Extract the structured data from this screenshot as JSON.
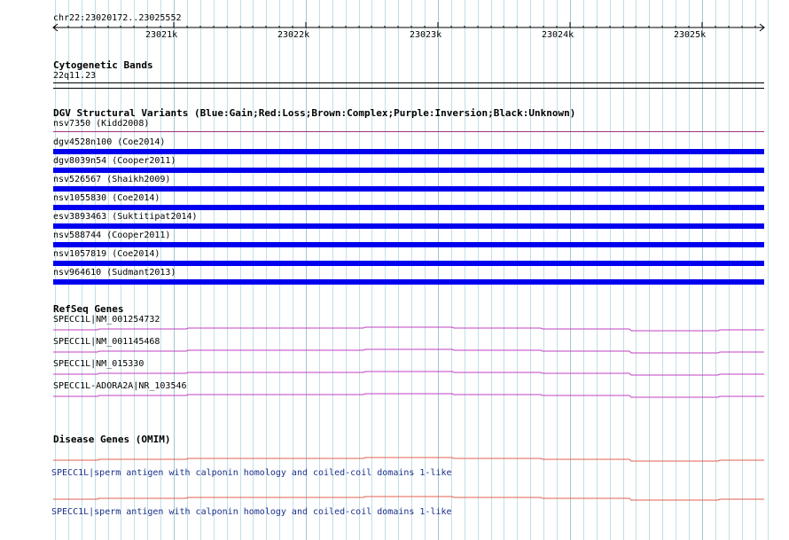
{
  "ruler": {
    "region_label": "chr22:23020172..23025552",
    "tick_labels": [
      "23021k",
      "23022k",
      "23023k",
      "23024k",
      "23025k"
    ]
  },
  "cytoband": {
    "title": "Cytogenetic Bands",
    "band": "22q11.23"
  },
  "dgv": {
    "title": "DGV Structural Variants (Blue:Gain;Red:Loss;Brown:Complex;Purple:Inversion;Black:Unknown)",
    "variants": [
      {
        "label": "nsv7350 (Kidd2008)",
        "color": "#a03080",
        "style": "thin"
      },
      {
        "label": "dgv4528n100 (Coe2014)",
        "color": "#0000ee",
        "style": "bar"
      },
      {
        "label": "dgv8039n54 (Cooper2011)",
        "color": "#0000ee",
        "style": "bar"
      },
      {
        "label": "nsv526567 (Shaikh2009)",
        "color": "#0000ee",
        "style": "bar"
      },
      {
        "label": "nsv1055830 (Coe2014)",
        "color": "#0000ee",
        "style": "bar"
      },
      {
        "label": "esv3893463 (Suktitipat2014)",
        "color": "#0000ee",
        "style": "bar"
      },
      {
        "label": "nsv588744 (Cooper2011)",
        "color": "#0000ee",
        "style": "bar"
      },
      {
        "label": "nsv1057819 (Coe2014)",
        "color": "#0000ee",
        "style": "bar"
      },
      {
        "label": "nsv964610 (Sudmant2013)",
        "color": "#0000ee",
        "style": "bar"
      }
    ]
  },
  "refseq": {
    "title": "RefSeq Genes",
    "color": "#c040c0",
    "genes": [
      {
        "label": "SPECC1L|NM_001254732"
      },
      {
        "label": "SPECC1L|NM_001145468"
      },
      {
        "label": "SPECC1L|NM_015330"
      },
      {
        "label": "SPECC1L-ADORA2A|NR_103546"
      }
    ]
  },
  "omim": {
    "title": "Disease Genes (OMIM)",
    "color": "#e06050",
    "genes": [
      {
        "label": "SPECC1L|sperm antigen with calponin homology and coiled-coil domains 1-like"
      },
      {
        "label": "SPECC1L|sperm antigen with calponin homology and coiled-coil domains 1-like"
      }
    ]
  }
}
